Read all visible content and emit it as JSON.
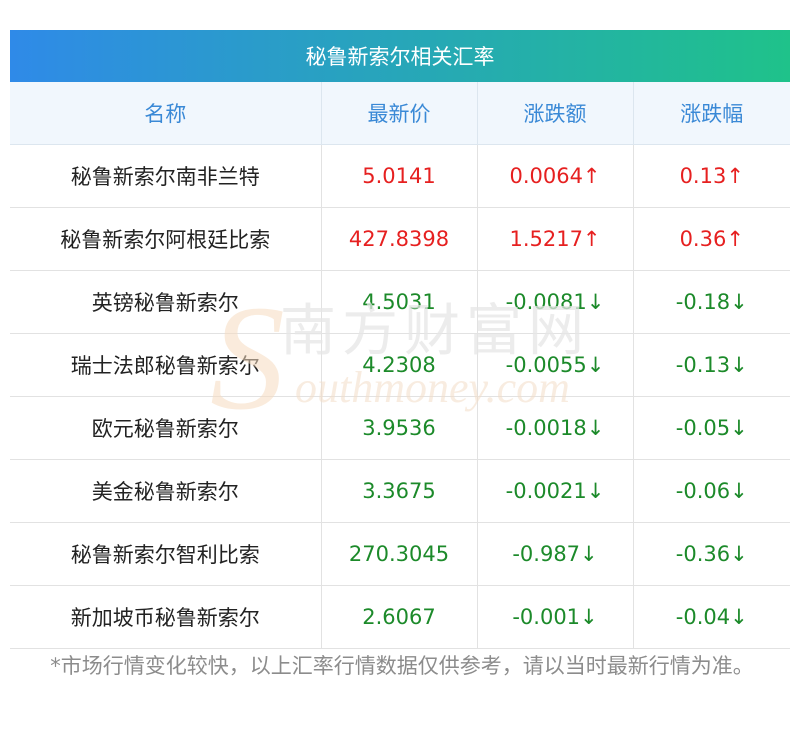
{
  "title": "秘鲁新索尔相关汇率",
  "headers": [
    "名称",
    "最新价",
    "涨跌额",
    "涨跌幅"
  ],
  "rows": [
    {
      "name": "秘鲁新索尔南非兰特",
      "price": "5.0141",
      "change": "0.0064↑",
      "pct": "0.13↑",
      "dir": "up"
    },
    {
      "name": "秘鲁新索尔阿根廷比索",
      "price": "427.8398",
      "change": "1.5217↑",
      "pct": "0.36↑",
      "dir": "up"
    },
    {
      "name": "英镑秘鲁新索尔",
      "price": "4.5031",
      "change": "-0.0081↓",
      "pct": "-0.18↓",
      "dir": "down"
    },
    {
      "name": "瑞士法郎秘鲁新索尔",
      "price": "4.2308",
      "change": "-0.0055↓",
      "pct": "-0.13↓",
      "dir": "down"
    },
    {
      "name": "欧元秘鲁新索尔",
      "price": "3.9536",
      "change": "-0.0018↓",
      "pct": "-0.05↓",
      "dir": "down"
    },
    {
      "name": "美金秘鲁新索尔",
      "price": "3.3675",
      "change": "-0.0021↓",
      "pct": "-0.06↓",
      "dir": "down"
    },
    {
      "name": "秘鲁新索尔智利比索",
      "price": "270.3045",
      "change": "-0.987↓",
      "pct": "-0.36↓",
      "dir": "down"
    },
    {
      "name": "新加坡币秘鲁新索尔",
      "price": "2.6067",
      "change": "-0.001↓",
      "pct": "-0.04↓",
      "dir": "down"
    }
  ],
  "note": "*市场行情变化较快，以上汇率行情数据仅供参考，请以当时最新行情为准。",
  "watermark": {
    "cn": "南方财富网",
    "en": "outhmoney.com",
    "en_initial": "S"
  },
  "colors": {
    "title_start": "#2f8ae8",
    "title_end": "#1fc28a",
    "header_text": "#3a89d6",
    "up": "#e62020",
    "down": "#1c8a2a"
  }
}
